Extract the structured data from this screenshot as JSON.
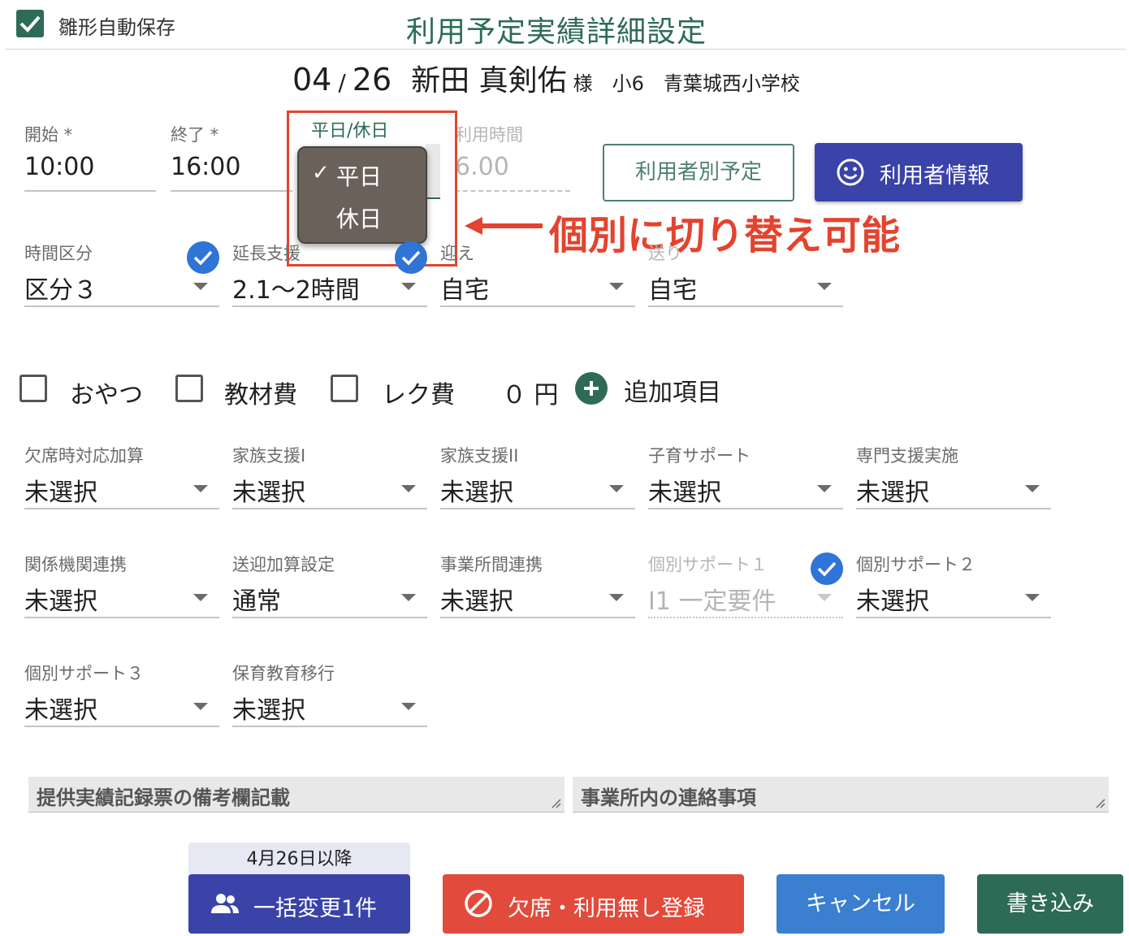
{
  "header": {
    "auto_save_label": "雛形自動保存",
    "auto_save_checked": true,
    "title": "利用予定実績詳細設定"
  },
  "record": {
    "month": "04",
    "separator": "/",
    "day": "26",
    "name": "新田 真剣佑",
    "honorific": "様",
    "grade": "小6",
    "school": "青葉城西小学校"
  },
  "time": {
    "start_label": "開始 *",
    "start_value": "10:00",
    "end_label": "終了 *",
    "end_value": "16:00",
    "day_type_label": "平日/休日",
    "day_type_options": [
      "平日",
      "休日"
    ],
    "day_type_selected": "平日",
    "check_mark": "✓",
    "usage_label": "利用時間",
    "usage_value": "6.00"
  },
  "buttons_top": {
    "user_schedule": "利用者別予定",
    "user_info": "利用者情報"
  },
  "annotation": {
    "text": "個別に切り替え可能",
    "color": "#e2442f"
  },
  "selects_row1": [
    {
      "label": "時間区分",
      "value": "区分３"
    },
    {
      "label": "延長支援",
      "value": "2.1〜2時間"
    },
    {
      "label": "迎え",
      "value": "自宅"
    },
    {
      "label": "送り",
      "value": "自宅"
    }
  ],
  "extras": {
    "snack": "おやつ",
    "material": "教材費",
    "recreation": "レク費",
    "amount": "０ 円",
    "add_item": "追加項目"
  },
  "addons_row1": [
    {
      "label": "欠席時対応加算",
      "value": "未選択"
    },
    {
      "label": "家族支援I",
      "value": "未選択"
    },
    {
      "label": "家族支援II",
      "value": "未選択"
    },
    {
      "label": "子育サポート",
      "value": "未選択"
    },
    {
      "label": "専門支援実施",
      "value": "未選択"
    }
  ],
  "addons_row2": [
    {
      "label": "関係機関連携",
      "value": "未選択"
    },
    {
      "label": "送迎加算設定",
      "value": "通常"
    },
    {
      "label": "事業所間連携",
      "value": "未選択"
    },
    {
      "label": "個別サポート１",
      "value": "I1 一定要件"
    },
    {
      "label": "個別サポート２",
      "value": "未選択"
    }
  ],
  "addons_row3": [
    {
      "label": "個別サポート３",
      "value": "未選択"
    },
    {
      "label": "保育教育移行",
      "value": "未選択"
    }
  ],
  "notes": {
    "record_remarks_placeholder": "提供実績記録票の備考欄記載",
    "office_contact_placeholder": "事業所内の連絡事項"
  },
  "footer": {
    "bulk_tab": "4月26日以降",
    "bulk_button": "一括変更1件",
    "absent_button": "欠席・利用無し登録",
    "cancel_button": "キャンセル",
    "write_button": "書き込み"
  },
  "colors": {
    "primary_green": "#2e6b57",
    "indigo": "#3a43a8",
    "danger": "#e24a3b",
    "blue": "#3a7fd0",
    "badge_blue": "#2f74d6"
  }
}
